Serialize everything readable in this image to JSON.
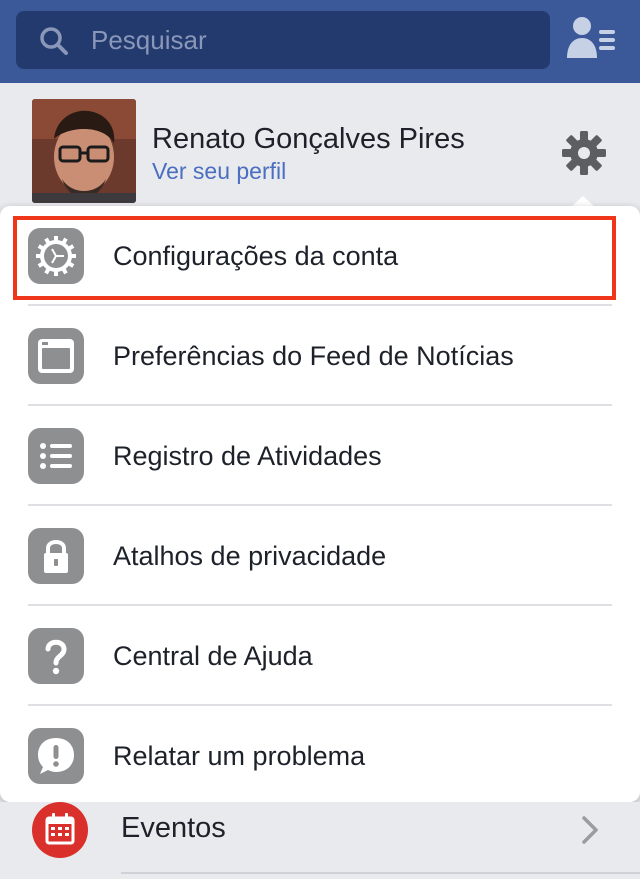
{
  "search": {
    "placeholder": "Pesquisar"
  },
  "profile": {
    "name": "Renato Gonçalves Pires",
    "link": "Ver seu perfil"
  },
  "menu": {
    "items": [
      {
        "label": "Configurações da conta",
        "icon": "settings-gear-icon",
        "highlighted": true
      },
      {
        "label": "Preferências do Feed de Notícias",
        "icon": "browser-window-icon"
      },
      {
        "label": "Registro de Atividades",
        "icon": "list-icon"
      },
      {
        "label": "Atalhos de privacidade",
        "icon": "lock-icon"
      },
      {
        "label": "Central de Ajuda",
        "icon": "question-mark-icon"
      },
      {
        "label": "Relatar um problema",
        "icon": "exclamation-bubble-icon"
      }
    ]
  },
  "events": {
    "label": "Eventos",
    "icon": "calendar-icon"
  },
  "colors": {
    "brand": "#3b5998",
    "link": "#4a6ec0",
    "highlight": "#f0361a",
    "icon_bg": "#8e8f91",
    "events_icon": "#d9302c"
  }
}
